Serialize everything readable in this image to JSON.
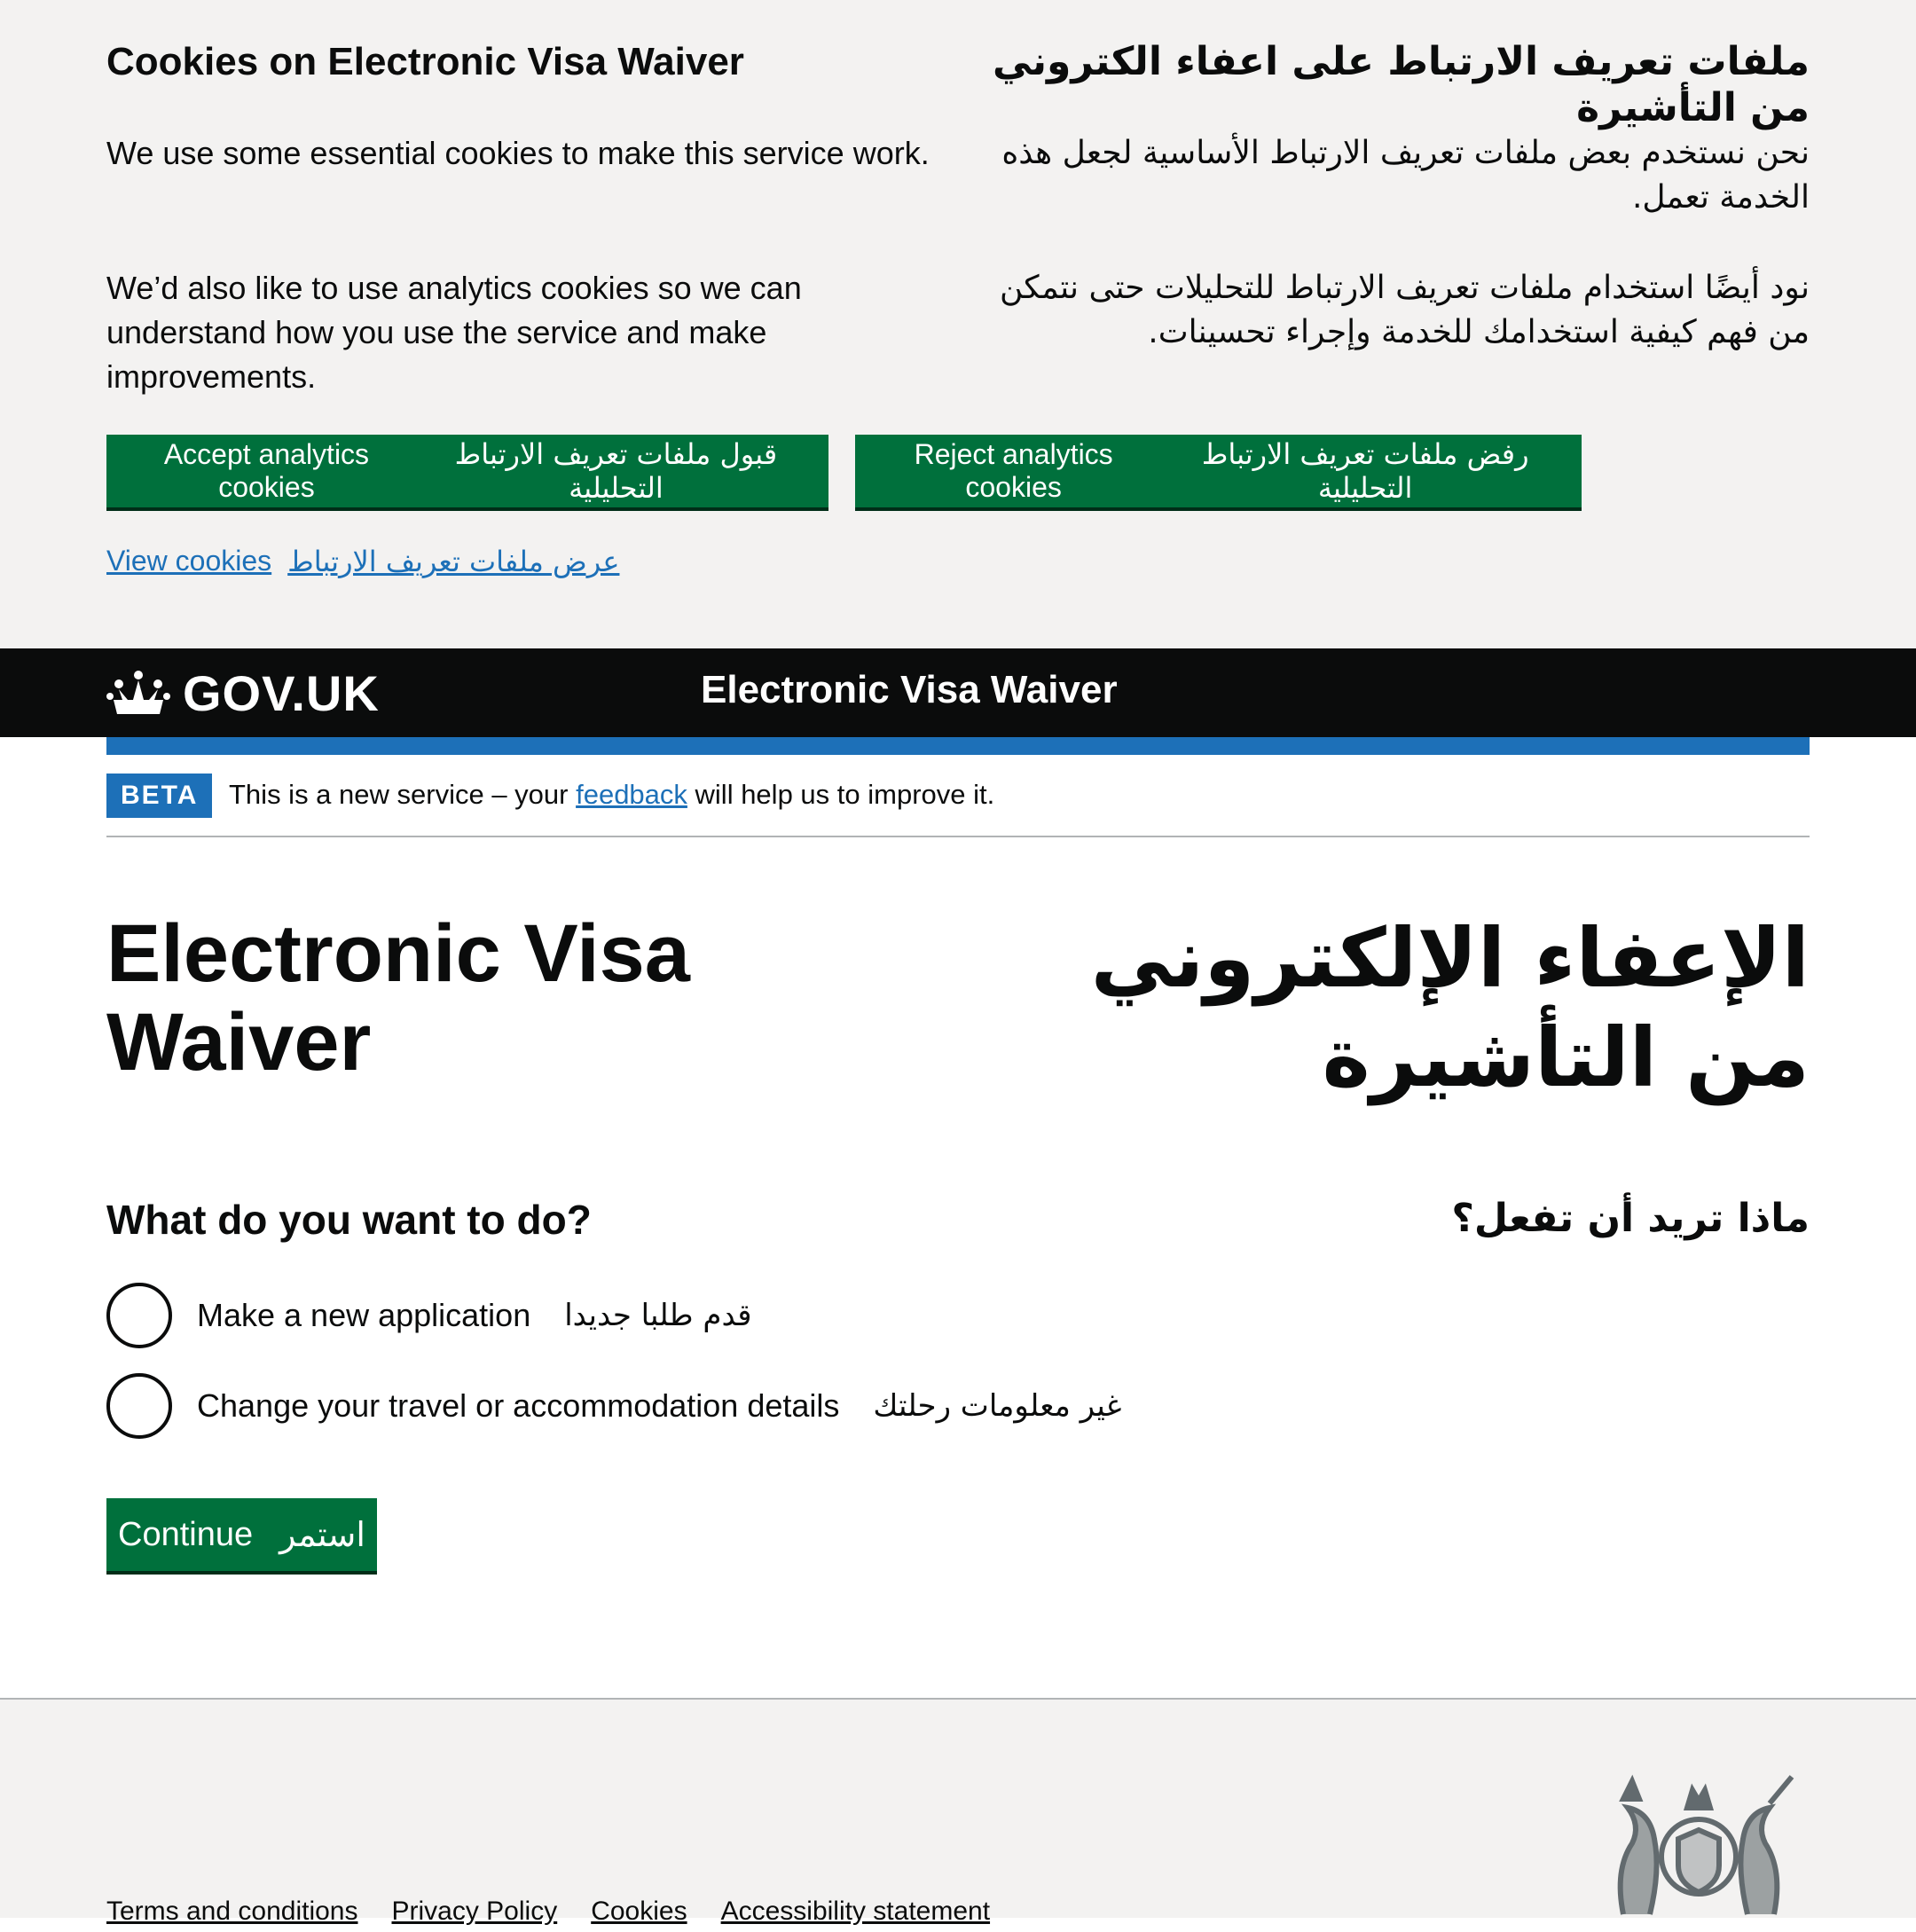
{
  "cookie_banner": {
    "heading_en": "Cookies on Electronic Visa Waiver",
    "heading_ar": "ملفات تعريف الارتباط على اعفاء الكتروني من التأشيرة",
    "p1_en": "We use some essential cookies to make this service work.",
    "p1_ar": "نحن نستخدم بعض ملفات تعريف الارتباط الأساسية لجعل هذه الخدمة تعمل.",
    "p2_en": "We’d also like to use analytics cookies so we can understand how you use the service and make improvements.",
    "p2_ar": "نود أيضًا استخدام ملفات تعريف الارتباط للتحليلات حتى نتمكن من فهم كيفية استخدامك للخدمة وإجراء تحسينات.",
    "accept_en": "Accept analytics cookies",
    "accept_ar": "قبول ملفات تعريف الارتباط التحليلية",
    "reject_en": "Reject analytics cookies",
    "reject_ar": "رفض ملفات تعريف الارتباط التحليلية",
    "view_en": "View cookies",
    "view_ar": "عرض ملفات تعريف الارتباط"
  },
  "header": {
    "logo_text": "GOV.UK",
    "service_name": "Electronic Visa Waiver"
  },
  "phase_banner": {
    "tag": "BETA",
    "text_before": "This is a new service – your ",
    "link": "feedback",
    "text_after": " will help us to improve it."
  },
  "main": {
    "title_en": "Electronic Visa Waiver",
    "title_ar": "الإعفاء الإلكتروني من التأشيرة",
    "question_en": "What do you want to do?",
    "question_ar": "ماذا تريد أن تفعل؟",
    "options": [
      {
        "label_en": "Make a new application",
        "label_ar": "قدم طلبا جديدا"
      },
      {
        "label_en": "Change your travel or accommodation details",
        "label_ar": "غير معلومات رحلتك"
      }
    ],
    "continue_en": "Continue",
    "continue_ar": "استمر"
  },
  "footer": {
    "links": [
      "Terms and conditions",
      "Privacy Policy",
      "Cookies",
      "Accessibility statement"
    ]
  },
  "colors": {
    "primary_green": "#00703c",
    "link_blue": "#1d70b8",
    "header_black": "#0b0c0c",
    "banner_grey": "#f3f2f1"
  }
}
